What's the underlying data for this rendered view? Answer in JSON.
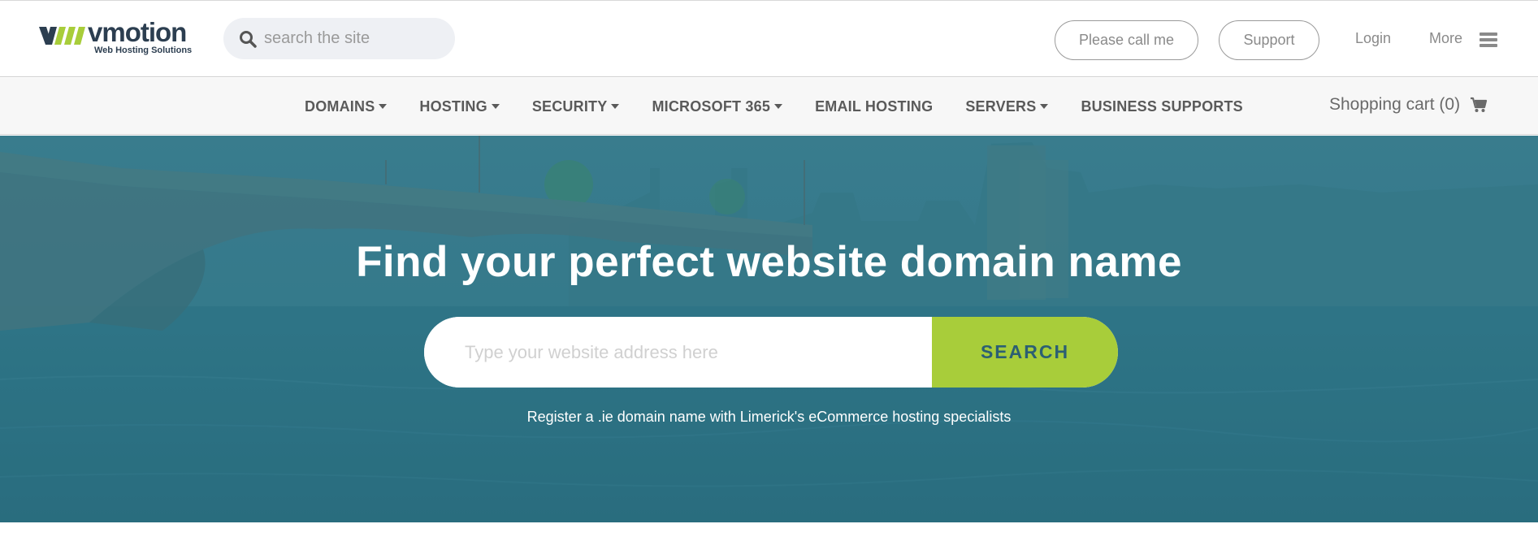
{
  "header": {
    "logo": {
      "word": "vmotion",
      "tagline": "Web Hosting Solutions",
      "mark_color": "#a8cd3a"
    },
    "site_search": {
      "placeholder": "search the site",
      "value": ""
    },
    "buttons": {
      "call": "Please call me",
      "support": "Support"
    },
    "links": {
      "login": "Login",
      "more": "More"
    }
  },
  "nav": {
    "items": [
      {
        "label": "DOMAINS",
        "dropdown": true
      },
      {
        "label": "HOSTING",
        "dropdown": true
      },
      {
        "label": "SECURITY",
        "dropdown": true
      },
      {
        "label": "MICROSOFT 365",
        "dropdown": true
      },
      {
        "label": "EMAIL HOSTING",
        "dropdown": false
      },
      {
        "label": "SERVERS",
        "dropdown": true
      },
      {
        "label": "BUSINESS SUPPORTS",
        "dropdown": false
      }
    ],
    "cart": {
      "label": "Shopping cart (0)",
      "icon": "cart-icon"
    }
  },
  "hero": {
    "title": "Find your perfect website domain name",
    "domain_search": {
      "placeholder": "Type your website address here",
      "value": "",
      "button": "SEARCH"
    },
    "subtitle": "Register a .ie domain name with Limerick's eCommerce hosting specialists",
    "accent_color": "#a8cd3a",
    "overlay_color": "#2f7384"
  }
}
